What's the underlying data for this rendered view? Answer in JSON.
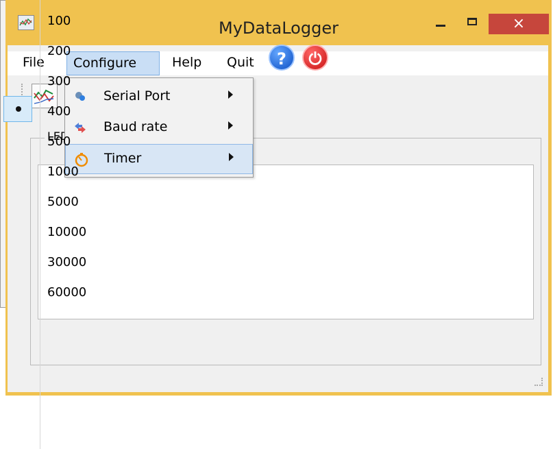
{
  "window": {
    "title": "MyDataLogger",
    "close_label": "×"
  },
  "menubar": {
    "items": [
      {
        "label": "File"
      },
      {
        "label": "Configure"
      },
      {
        "label": "Help"
      },
      {
        "label": "Quit"
      }
    ]
  },
  "toolbar": {
    "buttons": [
      {
        "icon": "chart-icon"
      },
      {
        "icon": "help-icon",
        "glyph": "?"
      },
      {
        "icon": "power-icon",
        "glyph": "⏻"
      }
    ]
  },
  "groupbox": {
    "label": "LED"
  },
  "configure_menu": {
    "items": [
      {
        "icon": "serial-port-icon",
        "label": "Serial Port",
        "has_submenu": true
      },
      {
        "icon": "baud-rate-icon",
        "label": "Baud rate",
        "has_submenu": true
      },
      {
        "icon": "timer-icon",
        "label": "Timer",
        "has_submenu": true,
        "highlighted": true
      }
    ]
  },
  "timer_submenu": {
    "selected": "400",
    "items": [
      "100",
      "200",
      "300",
      "400",
      "500",
      "1000",
      "5000",
      "10000",
      "30000",
      "60000"
    ]
  },
  "colors": {
    "title_bar": "#f0c24f",
    "close_button": "#c6463c",
    "menu_highlight": "#c9def5"
  }
}
